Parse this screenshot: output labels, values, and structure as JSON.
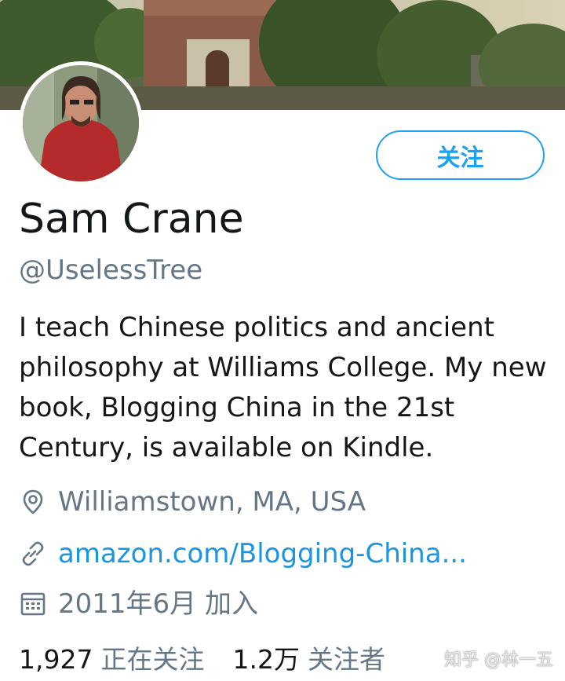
{
  "profile": {
    "name": "Sam Crane",
    "handle": "@UselessTree",
    "bio": "I teach Chinese politics and ancient philosophy at Williams College. My new book, Blogging China in the 21st Century, is available on Kindle.",
    "location": "Williamstown, MA, USA",
    "link": "amazon.com/Blogging-China...",
    "joined": "2011年6月 加入"
  },
  "actions": {
    "follow_label": "关注"
  },
  "stats": {
    "following_count": "1,927",
    "following_label": "正在关注",
    "followers_count": "1.2万",
    "followers_label": "关注者"
  },
  "watermark": "知乎 @林一五",
  "colors": {
    "accent": "#1da1f2",
    "link": "#1b95e0",
    "secondary_text": "#657786",
    "primary_text": "#14171a"
  },
  "icons": {
    "location": "location-pin-icon",
    "link": "link-icon",
    "joined": "calendar-icon"
  }
}
